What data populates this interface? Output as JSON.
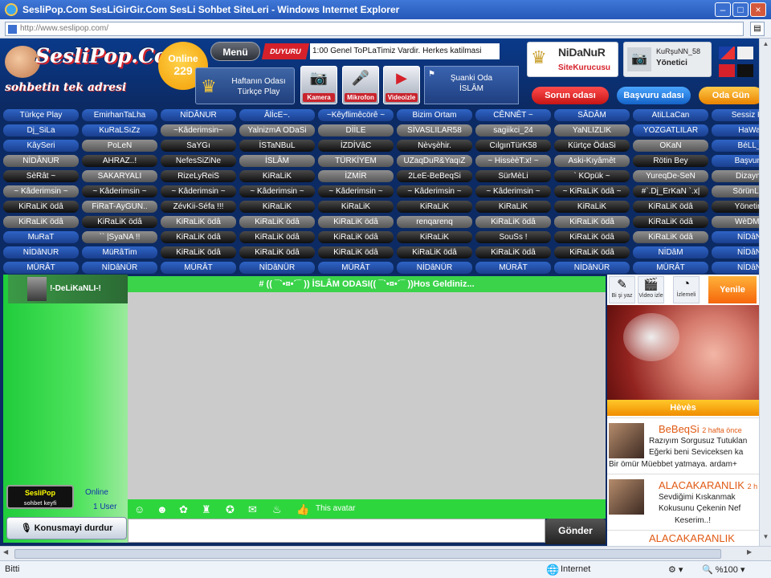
{
  "window": {
    "title": "SesliPop.Com SesLiGirGir.Com SesLi Sohbet SiteLeri - Windows Internet Explorer",
    "address": "http://www.seslipop.com/",
    "minimize": "–",
    "maximize": "□",
    "close": "×"
  },
  "header": {
    "logo_name": "SesliPop.CoM",
    "logo_slogan": "sohbetin tek adresi",
    "online_label": "Online",
    "online_count": "229",
    "menu_label": "Menü",
    "duyuru_label": "DUYURU",
    "announcement": "1:00 Genel ToPLaTimiz Vardir. Herkes katilmasi",
    "week_room_line1": "Haftanın Odası",
    "week_room_line2": "Türkçe Play",
    "buttons": [
      {
        "label": "Kamera",
        "icon": "camera-icon"
      },
      {
        "label": "Mikrofon",
        "icon": "microphone-icon"
      },
      {
        "label": "Videoizle",
        "icon": "youtube-icon"
      }
    ],
    "current_room_line1": "Şuanki Oda",
    "current_room_line2": "İSLÂM",
    "owner_name": "NiDaNuR",
    "owner_role": "SiteKurucusu",
    "admin_name": "KuRşuNN_58",
    "admin_role": "Yönetici",
    "problem_btn": "Sorun odası",
    "apply_btn": "Başvuru adası",
    "gold_btn": "Oda Gün"
  },
  "rooms": [
    {
      "label": "Türkçe Play",
      "c": "blue"
    },
    {
      "label": "EmirhanTaLha",
      "c": "blue"
    },
    {
      "label": "NİDÂNUR",
      "c": "blue"
    },
    {
      "label": "ÂlİcE~.",
      "c": "blue"
    },
    {
      "label": "~Kêyflimêcörê ~",
      "c": "blue"
    },
    {
      "label": "Bizim Ortam",
      "c": "blue"
    },
    {
      "label": "CÊNNÊT ~",
      "c": "blue"
    },
    {
      "label": "SÂDÂM",
      "c": "blue"
    },
    {
      "label": "AtiLLaCan",
      "c": "blue"
    },
    {
      "label": "Sessiz Ka",
      "c": "blue"
    },
    {
      "label": "Dj_SiLa",
      "c": "blue"
    },
    {
      "label": "KuRaLSıZz",
      "c": "blue"
    },
    {
      "label": "~Kâderimsin~",
      "c": "gray"
    },
    {
      "label": "YalnizmA ODaSi",
      "c": "gray"
    },
    {
      "label": "DİİLE",
      "c": "gray"
    },
    {
      "label": "SİVASLILAR58",
      "c": "gray"
    },
    {
      "label": "sagiikci_24",
      "c": "gray"
    },
    {
      "label": "YaNLIZLIK",
      "c": "gray"
    },
    {
      "label": "YOZGATLILAR",
      "c": "blue"
    },
    {
      "label": "HaWa",
      "c": "blue"
    },
    {
      "label": "KâySeri",
      "c": "blue"
    },
    {
      "label": "PoLeN",
      "c": "gray"
    },
    {
      "label": "SaYGı",
      "c": "black"
    },
    {
      "label": "İSTaNBuL",
      "c": "black"
    },
    {
      "label": "İZDİVâC",
      "c": "black"
    },
    {
      "label": "Nèvşèhir.",
      "c": "black"
    },
    {
      "label": "CılgınTürK58",
      "c": "black"
    },
    {
      "label": "Kürtçe ÖdaSi",
      "c": "black"
    },
    {
      "label": "OKaN",
      "c": "gray"
    },
    {
      "label": "BéLL_",
      "c": "blue"
    },
    {
      "label": "NİDÂNUR",
      "c": "gray"
    },
    {
      "label": "AHRAZ..!",
      "c": "black"
    },
    {
      "label": "NefesSiZiNe",
      "c": "black"
    },
    {
      "label": "İSLÂM",
      "c": "gray"
    },
    {
      "label": "TÜRKİYEM",
      "c": "gray"
    },
    {
      "label": "UZaqDuR&YaqıZ",
      "c": "gray"
    },
    {
      "label": "~ HissèèT.x! ~",
      "c": "gray"
    },
    {
      "label": "Aski-Kıyâmêt",
      "c": "gray"
    },
    {
      "label": "Rötin Bey",
      "c": "black"
    },
    {
      "label": "Başvuru",
      "c": "blue"
    },
    {
      "label": "SèRât ~",
      "c": "black"
    },
    {
      "label": "SAKARYALI",
      "c": "gray"
    },
    {
      "label": "RizeLyReiS",
      "c": "black"
    },
    {
      "label": "KiRaLiK",
      "c": "black"
    },
    {
      "label": "İZMİR",
      "c": "gray"
    },
    {
      "label": "2LeE-BeBeqSi",
      "c": "black"
    },
    {
      "label": "SürMèLi",
      "c": "black"
    },
    {
      "label": "` KOpük ~",
      "c": "black"
    },
    {
      "label": "YureqDe-SeN",
      "c": "gray"
    },
    {
      "label": "Dizayn`",
      "c": "gray"
    },
    {
      "label": "~ Kâderimsin ~",
      "c": "gray"
    },
    {
      "label": "~ Kâderimsin ~",
      "c": "black"
    },
    {
      "label": "~ Kâderimsin ~",
      "c": "black"
    },
    {
      "label": "~ Kâderimsin ~",
      "c": "black"
    },
    {
      "label": "~ Kâderimsin ~",
      "c": "black"
    },
    {
      "label": "~ Kâderimsin ~",
      "c": "black"
    },
    {
      "label": "~ Kâderimsin ~",
      "c": "black"
    },
    {
      "label": "~ KiRaLiK ödâ ~",
      "c": "black"
    },
    {
      "label": "#`.Dj_ErKaN `.x|",
      "c": "black"
    },
    {
      "label": "SörünLar",
      "c": "gray"
    },
    {
      "label": "KiRaLiK ödâ",
      "c": "black"
    },
    {
      "label": "FiRaT-AyGUN..",
      "c": "gray"
    },
    {
      "label": "ZévKii-Séfa !!!",
      "c": "black"
    },
    {
      "label": "KiRaLiK",
      "c": "black"
    },
    {
      "label": "KiRaLiK",
      "c": "black"
    },
    {
      "label": "KiRaLiK",
      "c": "black"
    },
    {
      "label": "KiRaLiK",
      "c": "black"
    },
    {
      "label": "KiRaLiK",
      "c": "black"
    },
    {
      "label": "KiRaLiK ödâ",
      "c": "black"
    },
    {
      "label": "Yönetim",
      "c": "black"
    },
    {
      "label": "KiRaLiK ödâ",
      "c": "gray"
    },
    {
      "label": "KiRaLiK ödâ",
      "c": "black"
    },
    {
      "label": "KiRaLiK ödâ",
      "c": "gray"
    },
    {
      "label": "KiRaLiK ödâ",
      "c": "gray"
    },
    {
      "label": "KiRaLiK ödâ",
      "c": "gray"
    },
    {
      "label": "renqarenq",
      "c": "gray"
    },
    {
      "label": "KiRaLiK ödâ",
      "c": "gray"
    },
    {
      "label": "KiRaLiK ödâ",
      "c": "gray"
    },
    {
      "label": "KiRaLiK ödâ",
      "c": "black"
    },
    {
      "label": "WèDMâ",
      "c": "gray"
    },
    {
      "label": "MuRaT",
      "c": "blue"
    },
    {
      "label": "`` |SyaNA !!",
      "c": "gray"
    },
    {
      "label": "KiRaLiK ödâ",
      "c": "black"
    },
    {
      "label": "KiRaLiK ödâ",
      "c": "black"
    },
    {
      "label": "KiRaLiK ödâ",
      "c": "black"
    },
    {
      "label": "KiRaLiK",
      "c": "black"
    },
    {
      "label": "SouSs !",
      "c": "black"
    },
    {
      "label": "KiRaLiK ödâ",
      "c": "black"
    },
    {
      "label": "KiRaLiK ödâ",
      "c": "gray"
    },
    {
      "label": "NİDâN",
      "c": "blue"
    },
    {
      "label": "NİDâNUR",
      "c": "blue"
    },
    {
      "label": "MüRâTim",
      "c": "blue"
    },
    {
      "label": "KiRaLiK ödâ",
      "c": "black"
    },
    {
      "label": "KiRaLiK ödâ",
      "c": "black"
    },
    {
      "label": "KiRaLiK ödâ",
      "c": "black"
    },
    {
      "label": "KiRaLiK ödâ",
      "c": "black"
    },
    {
      "label": "KiRaLiK ödâ",
      "c": "black"
    },
    {
      "label": "KiRaLiK ödâ",
      "c": "black"
    },
    {
      "label": "NİDâM",
      "c": "blue"
    },
    {
      "label": "NİDâN",
      "c": "blue"
    },
    {
      "label": "MÜRÂT",
      "c": "blue"
    },
    {
      "label": "NİDâNÜR",
      "c": "blue"
    },
    {
      "label": "MÜRÂT",
      "c": "blue"
    },
    {
      "label": "NİDâNÜR",
      "c": "blue"
    },
    {
      "label": "MÜRÂT",
      "c": "blue"
    },
    {
      "label": "NİDâNÜR",
      "c": "blue"
    },
    {
      "label": "MÜRÂT",
      "c": "blue"
    },
    {
      "label": "NİDâNÜR",
      "c": "blue"
    },
    {
      "label": "MÜRÂT",
      "c": "blue"
    },
    {
      "label": "NİDâN",
      "c": "blue"
    }
  ],
  "chat": {
    "user_name": "!-DeLiKaNLI-!",
    "welcome": "# (( ¯`•¤•´¯ )) İSLÂM ODASI(( ¯`•¤•´¯ ))Hos Geldiniz...",
    "left_logo": "SesliPop",
    "left_logo_sub": "sohbet keyfi",
    "online_label": "Online",
    "user_count": "1 User",
    "oyun_label": "This avatar",
    "stop_btn": "Konusmayi durdur",
    "send_btn": "Gönder"
  },
  "right": {
    "tools": [
      {
        "label": "Bi şi yaz",
        "icon": "pencil-icon"
      },
      {
        "label": "Video izle",
        "icon": "video-icon"
      },
      {
        "label": "İzlemeli",
        "icon": "chart-icon"
      }
    ],
    "yenile": "Yenile",
    "ad_caption": "Hèvès",
    "posts": [
      {
        "name": "BeBeqSi",
        "ago": "2 hafta önce",
        "l1": "Razıyım Sorgusuz Tutuklan",
        "l2": "Eğerki beni Seviceksen ka",
        "l3": "Bir ömür Müebbet yatmaya. ardam+"
      },
      {
        "name": "ALACAKARANLIK",
        "ago": "2 h",
        "l1": "Sevdiğimi Kıskanmak",
        "l2": "Kokusunu Çekenin Nef",
        "l3": "Keserim..!"
      },
      {
        "name": "ALACAKARANLIK",
        "ago": "",
        "l1": "",
        "l2": "",
        "l3": ""
      }
    ]
  },
  "status": {
    "left": "Bitti",
    "zone": "Internet",
    "zoom": "%100"
  },
  "colors": {
    "accent_green": "#2ed63e",
    "header_blue": "#0c2a63",
    "duyuru_red": "#d6212b"
  }
}
